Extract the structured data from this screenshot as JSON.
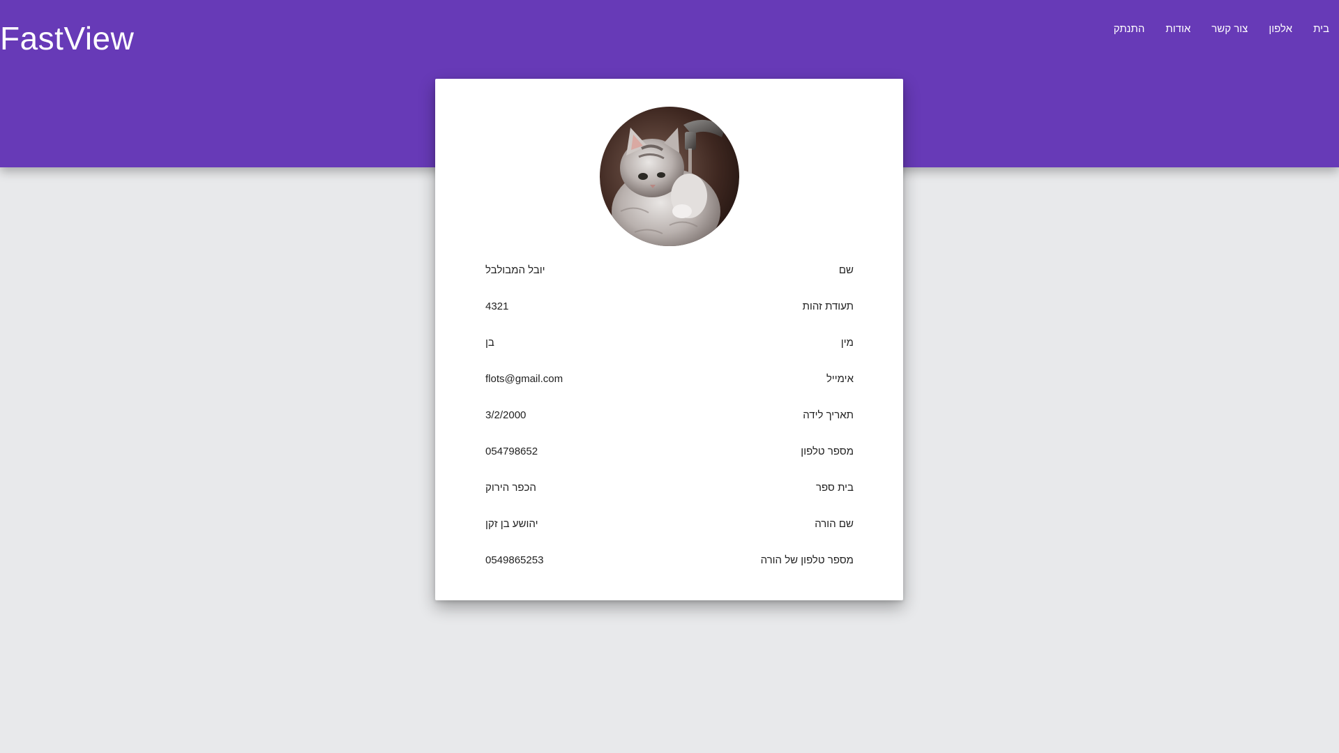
{
  "header": {
    "brand": "FastView",
    "color": "#673ab7",
    "nav": [
      {
        "label": "בית"
      },
      {
        "label": "אלפון"
      },
      {
        "label": "צור קשר"
      },
      {
        "label": "אודות"
      },
      {
        "label": "התנתק"
      }
    ]
  },
  "profile": {
    "avatar_icon": "kitten-photo",
    "rows": [
      {
        "label": "שם",
        "value": "יובל המבולבל"
      },
      {
        "label": "תעודת זהות",
        "value": "4321"
      },
      {
        "label": "מין",
        "value": "בן"
      },
      {
        "label": "אימייל",
        "value": "flots@gmail.com"
      },
      {
        "label": "תאריך לידה",
        "value": "3/2/2000"
      },
      {
        "label": "מספר טלפון",
        "value": "054798652"
      },
      {
        "label": "בית ספר",
        "value": "הכפר הירוק"
      },
      {
        "label": "שם הורה",
        "value": "יהושע בן זקן"
      },
      {
        "label": "מספר טלפון של הורה",
        "value": "0549865253"
      }
    ]
  }
}
